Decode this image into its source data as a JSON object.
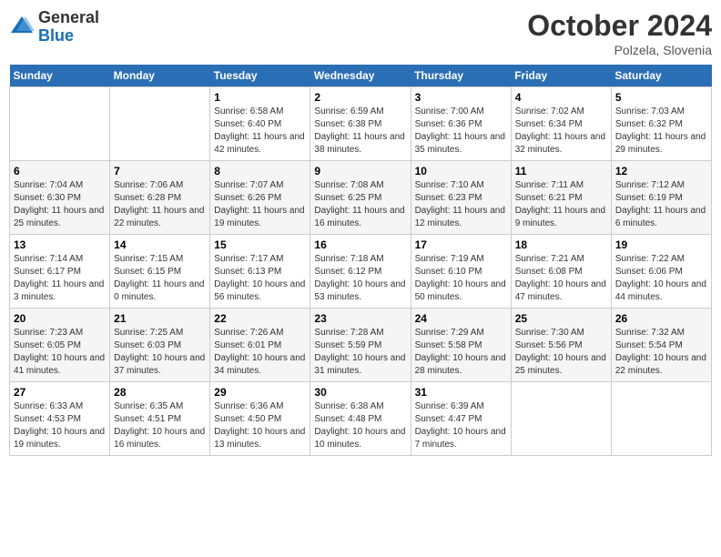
{
  "header": {
    "logo_general": "General",
    "logo_blue": "Blue",
    "month_title": "October 2024",
    "subtitle": "Polzela, Slovenia"
  },
  "days_of_week": [
    "Sunday",
    "Monday",
    "Tuesday",
    "Wednesday",
    "Thursday",
    "Friday",
    "Saturday"
  ],
  "weeks": [
    [
      {
        "day": "",
        "info": ""
      },
      {
        "day": "",
        "info": ""
      },
      {
        "day": "1",
        "info": "Sunrise: 6:58 AM\nSunset: 6:40 PM\nDaylight: 11 hours and 42 minutes."
      },
      {
        "day": "2",
        "info": "Sunrise: 6:59 AM\nSunset: 6:38 PM\nDaylight: 11 hours and 38 minutes."
      },
      {
        "day": "3",
        "info": "Sunrise: 7:00 AM\nSunset: 6:36 PM\nDaylight: 11 hours and 35 minutes."
      },
      {
        "day": "4",
        "info": "Sunrise: 7:02 AM\nSunset: 6:34 PM\nDaylight: 11 hours and 32 minutes."
      },
      {
        "day": "5",
        "info": "Sunrise: 7:03 AM\nSunset: 6:32 PM\nDaylight: 11 hours and 29 minutes."
      }
    ],
    [
      {
        "day": "6",
        "info": "Sunrise: 7:04 AM\nSunset: 6:30 PM\nDaylight: 11 hours and 25 minutes."
      },
      {
        "day": "7",
        "info": "Sunrise: 7:06 AM\nSunset: 6:28 PM\nDaylight: 11 hours and 22 minutes."
      },
      {
        "day": "8",
        "info": "Sunrise: 7:07 AM\nSunset: 6:26 PM\nDaylight: 11 hours and 19 minutes."
      },
      {
        "day": "9",
        "info": "Sunrise: 7:08 AM\nSunset: 6:25 PM\nDaylight: 11 hours and 16 minutes."
      },
      {
        "day": "10",
        "info": "Sunrise: 7:10 AM\nSunset: 6:23 PM\nDaylight: 11 hours and 12 minutes."
      },
      {
        "day": "11",
        "info": "Sunrise: 7:11 AM\nSunset: 6:21 PM\nDaylight: 11 hours and 9 minutes."
      },
      {
        "day": "12",
        "info": "Sunrise: 7:12 AM\nSunset: 6:19 PM\nDaylight: 11 hours and 6 minutes."
      }
    ],
    [
      {
        "day": "13",
        "info": "Sunrise: 7:14 AM\nSunset: 6:17 PM\nDaylight: 11 hours and 3 minutes."
      },
      {
        "day": "14",
        "info": "Sunrise: 7:15 AM\nSunset: 6:15 PM\nDaylight: 11 hours and 0 minutes."
      },
      {
        "day": "15",
        "info": "Sunrise: 7:17 AM\nSunset: 6:13 PM\nDaylight: 10 hours and 56 minutes."
      },
      {
        "day": "16",
        "info": "Sunrise: 7:18 AM\nSunset: 6:12 PM\nDaylight: 10 hours and 53 minutes."
      },
      {
        "day": "17",
        "info": "Sunrise: 7:19 AM\nSunset: 6:10 PM\nDaylight: 10 hours and 50 minutes."
      },
      {
        "day": "18",
        "info": "Sunrise: 7:21 AM\nSunset: 6:08 PM\nDaylight: 10 hours and 47 minutes."
      },
      {
        "day": "19",
        "info": "Sunrise: 7:22 AM\nSunset: 6:06 PM\nDaylight: 10 hours and 44 minutes."
      }
    ],
    [
      {
        "day": "20",
        "info": "Sunrise: 7:23 AM\nSunset: 6:05 PM\nDaylight: 10 hours and 41 minutes."
      },
      {
        "day": "21",
        "info": "Sunrise: 7:25 AM\nSunset: 6:03 PM\nDaylight: 10 hours and 37 minutes."
      },
      {
        "day": "22",
        "info": "Sunrise: 7:26 AM\nSunset: 6:01 PM\nDaylight: 10 hours and 34 minutes."
      },
      {
        "day": "23",
        "info": "Sunrise: 7:28 AM\nSunset: 5:59 PM\nDaylight: 10 hours and 31 minutes."
      },
      {
        "day": "24",
        "info": "Sunrise: 7:29 AM\nSunset: 5:58 PM\nDaylight: 10 hours and 28 minutes."
      },
      {
        "day": "25",
        "info": "Sunrise: 7:30 AM\nSunset: 5:56 PM\nDaylight: 10 hours and 25 minutes."
      },
      {
        "day": "26",
        "info": "Sunrise: 7:32 AM\nSunset: 5:54 PM\nDaylight: 10 hours and 22 minutes."
      }
    ],
    [
      {
        "day": "27",
        "info": "Sunrise: 6:33 AM\nSunset: 4:53 PM\nDaylight: 10 hours and 19 minutes."
      },
      {
        "day": "28",
        "info": "Sunrise: 6:35 AM\nSunset: 4:51 PM\nDaylight: 10 hours and 16 minutes."
      },
      {
        "day": "29",
        "info": "Sunrise: 6:36 AM\nSunset: 4:50 PM\nDaylight: 10 hours and 13 minutes."
      },
      {
        "day": "30",
        "info": "Sunrise: 6:38 AM\nSunset: 4:48 PM\nDaylight: 10 hours and 10 minutes."
      },
      {
        "day": "31",
        "info": "Sunrise: 6:39 AM\nSunset: 4:47 PM\nDaylight: 10 hours and 7 minutes."
      },
      {
        "day": "",
        "info": ""
      },
      {
        "day": "",
        "info": ""
      }
    ]
  ]
}
